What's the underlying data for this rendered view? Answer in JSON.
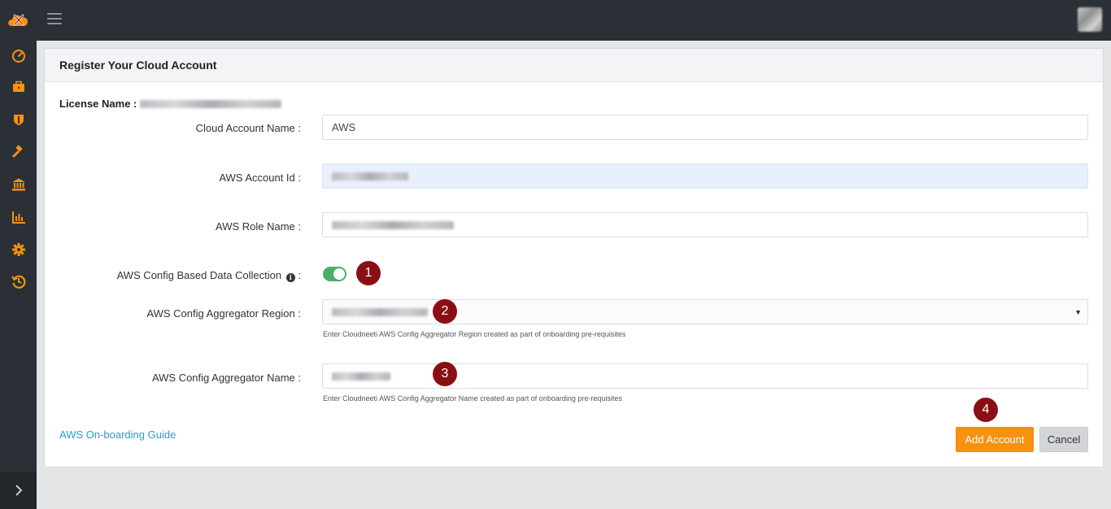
{
  "nav": {
    "logo_icon": "cloud-tools-logo",
    "menu_icon": "hamburger-menu-icon",
    "sidebar_icons": [
      "dashboard-gauge-icon",
      "briefcase-icon",
      "shield-icon",
      "gavel-icon",
      "bank-icon",
      "bar-chart-icon",
      "gear-icon",
      "history-icon"
    ],
    "expand_icon": "chevron-right-icon",
    "accent_color": "#f7920f"
  },
  "card": {
    "title": "Register Your Cloud Account",
    "license_label": "License Name :"
  },
  "form": {
    "cloud_account_name": {
      "label": "Cloud Account Name :",
      "value": "AWS"
    },
    "aws_account_id": {
      "label": "AWS Account Id :"
    },
    "aws_role_name": {
      "label": "AWS Role Name :"
    },
    "config_collection": {
      "label": "AWS Config Based Data Collection",
      "suffix": ":",
      "info_glyph": "i",
      "enabled": true
    },
    "aggregator_region": {
      "label": "AWS Config Aggregator Region :",
      "arrow": "▼",
      "help": "Enter Cloudneeti AWS Config Aggregator Region created as part of onboarding pre-requisites"
    },
    "aggregator_name": {
      "label": "AWS Config Aggregator Name :",
      "help": "Enter Cloudneeti AWS Config Aggregator Name created as part of onboarding pre-requisites"
    }
  },
  "markers": [
    "1",
    "2",
    "3",
    "4"
  ],
  "footer": {
    "guide_link": "AWS On-boarding Guide",
    "add_button": "Add Account",
    "cancel_button": "Cancel"
  }
}
